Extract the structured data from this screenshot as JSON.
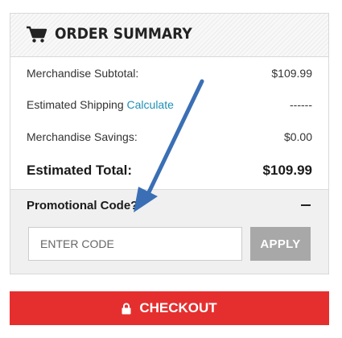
{
  "summary": {
    "title": "ORDER SUMMARY",
    "cart_icon": "shopping-cart-icon",
    "rows": [
      {
        "label": "Merchandise Subtotal:",
        "value": "$109.99"
      },
      {
        "label": "Estimated Shipping",
        "link": "Calculate",
        "value": "------"
      },
      {
        "label": "Merchandise Savings:",
        "value": "$0.00"
      }
    ],
    "total": {
      "label": "Estimated Total:",
      "value": "$109.99"
    }
  },
  "promo": {
    "title": "Promotional Code?",
    "toggle_icon": "minus-icon",
    "input_placeholder": "ENTER CODE",
    "input_value": "",
    "apply_label": "APPLY"
  },
  "checkout": {
    "label": "CHECKOUT",
    "icon": "lock-icon"
  },
  "annotation": {
    "arrow_icon": "arrow-icon"
  },
  "colors": {
    "checkout_bg": "#e52f2f",
    "apply_bg": "#a8a8a8",
    "link": "#1f8fb5",
    "arrow": "#3a6fb5"
  }
}
